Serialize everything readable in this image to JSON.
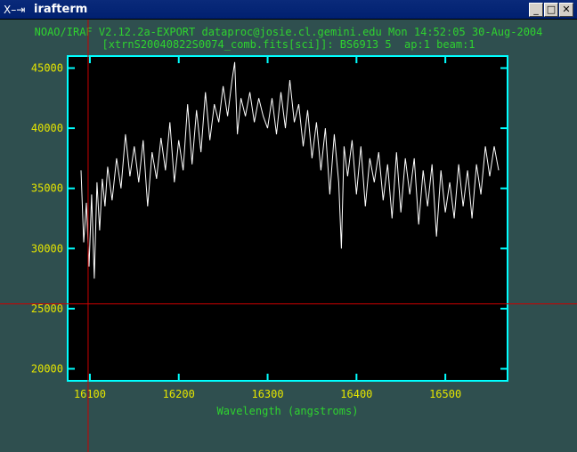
{
  "window": {
    "title": "irafterm",
    "icon": "x-logo-icon",
    "controls": {
      "minimize": "_",
      "maximize": "□",
      "close": "✕"
    }
  },
  "header": {
    "line1": "NOAO/IRAF V2.12.2a-EXPORT dataproc@josie.cl.gemini.edu Mon 14:52:05 30-Aug-2004",
    "line2": "[xtrnS20040822S0074_comb.fits[sci]]: BS6913 5  ap:1 beam:1"
  },
  "colors": {
    "background": "#2f4f4f",
    "plot_background": "#000000",
    "frame": "#00ffff",
    "text": "#2fd32f",
    "ticks": "#e5e500",
    "trace": "#ffffff",
    "cursor": "#cc0000"
  },
  "cursor": {
    "x": 16098,
    "y": 25400
  },
  "chart_data": {
    "type": "line",
    "title": "[xtrnS20040822S0074_comb.fits[sci]]: BS6913 5  ap:1 beam:1",
    "xlabel": "Wavelength (angstroms)",
    "ylabel": "",
    "xlim": [
      16075,
      16570
    ],
    "ylim": [
      19000,
      46000
    ],
    "xticks": [
      16100,
      16200,
      16300,
      16400,
      16500
    ],
    "yticks": [
      20000,
      25000,
      30000,
      35000,
      40000,
      45000
    ],
    "grid": false,
    "series": [
      {
        "x": [
          16090,
          16093,
          16096,
          16099,
          16102,
          16105,
          16108,
          16111,
          16114,
          16117,
          16120,
          16125,
          16130,
          16135,
          16140,
          16145,
          16150,
          16155,
          16160,
          16165,
          16170,
          16175,
          16180,
          16185,
          16190,
          16195,
          16200,
          16205,
          16210,
          16215,
          16220,
          16225,
          16230,
          16235,
          16240,
          16245,
          16250,
          16255,
          16260,
          16263,
          16266,
          16270,
          16275,
          16280,
          16285,
          16290,
          16295,
          16300,
          16305,
          16310,
          16315,
          16320,
          16325,
          16330,
          16335,
          16340,
          16345,
          16350,
          16355,
          16360,
          16365,
          16370,
          16375,
          16380,
          16383,
          16386,
          16390,
          16395,
          16400,
          16405,
          16410,
          16415,
          16420,
          16425,
          16430,
          16435,
          16440,
          16445,
          16450,
          16455,
          16460,
          16465,
          16470,
          16475,
          16480,
          16485,
          16490,
          16495,
          16500,
          16505,
          16510,
          16515,
          16520,
          16525,
          16530,
          16535,
          16540,
          16545,
          16550,
          16555,
          16560
        ],
        "values": [
          36500,
          30500,
          33800,
          28500,
          34500,
          27500,
          35500,
          31500,
          35800,
          33500,
          36800,
          34000,
          37500,
          35000,
          39500,
          36000,
          38500,
          35500,
          39000,
          33500,
          38000,
          35800,
          39200,
          36500,
          40500,
          35500,
          39000,
          36500,
          42000,
          37000,
          41500,
          38000,
          43000,
          39000,
          42000,
          40500,
          43500,
          41000,
          44000,
          45500,
          39500,
          42500,
          41000,
          43000,
          40500,
          42500,
          41000,
          40000,
          42500,
          39500,
          43000,
          40000,
          44000,
          40500,
          42000,
          38500,
          41500,
          37500,
          40500,
          36500,
          40000,
          34500,
          39500,
          35500,
          30000,
          38500,
          36000,
          39000,
          34500,
          38500,
          33500,
          37500,
          35500,
          38000,
          34000,
          37000,
          32500,
          38000,
          33000,
          37500,
          34500,
          37500,
          32000,
          36500,
          33500,
          37000,
          31000,
          36500,
          33000,
          35500,
          32500,
          37000,
          33500,
          36500,
          32500,
          37000,
          34500,
          38500,
          36000,
          38500,
          36500
        ]
      }
    ]
  }
}
